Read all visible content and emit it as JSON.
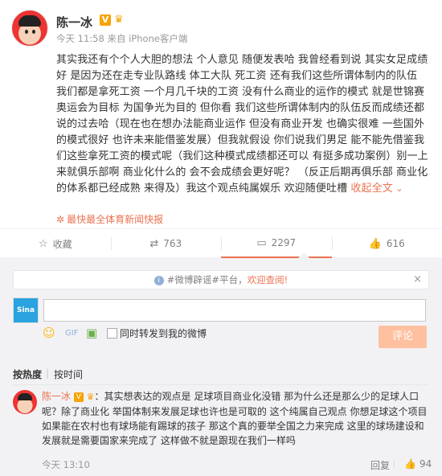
{
  "post": {
    "author": "陈一冰",
    "time": "今天 11:58",
    "source_prefix": "来自",
    "source": "iPhone客户端",
    "text": "其实我还有个个人大胆的想法 个人意见 随便发表哈 我曾经看到说 其实女足成绩好 是因为还在走专业队路线 体工大队 死工资 还有我们这些所谓体制内的队伍 我们都是拿死工资 一个月几千块的工资 没有什么商业的运作的模式 就是世锦赛 奥运会为目标 为国争光为目的 但你看 我们这些所谓体制内的队伍反而成绩还都说的过去哈（现在也在想办法能商业运作 但没有商业开发 也确实很难 一些国外的模式很好 也许未来能借鉴发展）但我就假设 你们说我们男足 能不能先借鉴我们这些拿死工资的模式呢（我们这种模式成绩都还可以 有挺多成功案例）别一上来就俱乐部啊 商业化什么的 会不会成绩会更好呢？ （反正后期再俱乐部 商业化的体系都已经成熟 来得及）我这个观点纯属娱乐 欢迎随便吐槽 ",
    "collapse_label": "收起全文",
    "activity": "最快最全体育新闻快报"
  },
  "actions": {
    "favorite": "收藏",
    "repost": "763",
    "comment": "2297",
    "like": "616"
  },
  "rumor_bar": {
    "prefix": "#微博辟谣#平台，",
    "link": "欢迎查阅!"
  },
  "comment_box": {
    "avatar_label": "Sina",
    "repost_label": "同时转发到我的微博",
    "submit_label": "评论"
  },
  "sort": {
    "hot": "按热度",
    "divider": "|",
    "time": "按时间"
  },
  "comment": {
    "name": "陈一冰",
    "text": "：其实想表达的观点是 足球项目商业化没错 那为什么还是那么少的足球人口呢？除了商业化 举国体制来发展足球也许也是可取的 这个纯属自己观点 你想足球这个项目如果能在农村也有球场能有踢球的孩子 那这个真的要举全国之力来完成 这里的球场建设和发展就是需要国家来完成了 这样做不就是跟现在我们一样吗",
    "time": "今天 13:10",
    "reply": "回复",
    "likes": "94"
  },
  "colors": {
    "accent": "#eb7350",
    "badge": "#f7a300",
    "submit_disabled": "#ffc09f"
  }
}
